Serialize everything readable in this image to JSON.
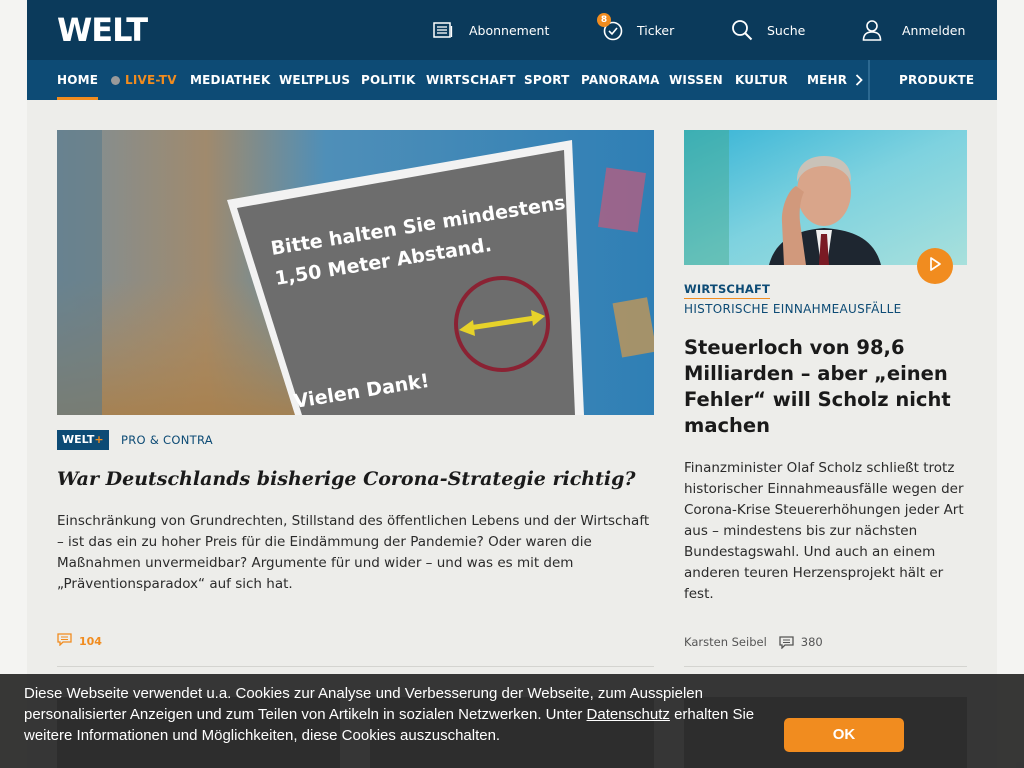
{
  "brand": {
    "logo_text": "WELT",
    "accent_color": "#f18c1f",
    "primary_color": "#0b3a5b"
  },
  "header": {
    "links": [
      {
        "label": "Abonnement",
        "icon": "newspaper-icon"
      },
      {
        "label": "Ticker",
        "icon": "clock-icon",
        "badge": "8"
      },
      {
        "label": "Suche",
        "icon": "search-icon"
      },
      {
        "label": "Anmelden",
        "icon": "user-icon"
      }
    ]
  },
  "nav": {
    "items": [
      "HOME",
      "LIVE-TV",
      "MEDIATHEK",
      "WELTPLUS",
      "POLITIK",
      "WIRTSCHAFT",
      "SPORT",
      "PANORAMA",
      "WISSEN",
      "KULTUR",
      "MEHR"
    ],
    "active": "HOME",
    "produkte": "PRODUKTE"
  },
  "left_article": {
    "image_sign_lines": [
      "Bitte halten Sie mindestens",
      "1,50 Meter Abstand.",
      "Vielen Dank!"
    ],
    "badge": {
      "text": "WELT",
      "plus": "+"
    },
    "kicker": "PRO & CONTRA",
    "headline": "War Deutschlands bisherige Corona-Strategie richtig?",
    "teaser": "Einschränkung von Grundrechten, Stillstand des öffentlichen Lebens und der Wirtschaft – ist das ein zu hoher Preis für die Eindämmung der Pandemie? Oder waren die Maßnahmen unvermeidbar? Argumente für und wider – und was es mit dem „Präventionsparadox“ auf sich hat.",
    "comments": "104"
  },
  "right_article": {
    "section": "WIRTSCHAFT",
    "kicker": "HISTORISCHE EINNAHMEAUSFÄLLE",
    "headline": "Steuerloch von 98,6 Milliarden – aber „einen Fehler“ will Scholz nicht machen",
    "teaser": "Finanzminister Olaf Scholz schließt trotz historischer Einnahmeausfälle wegen der Corona-Krise Steuererhöhungen jeder Art aus – mindestens bis zur nächsten Bundestagswahl. Und auch an einem anderen teuren Herzensprojekt hält er fest.",
    "author": "Karsten Seibel",
    "comments": "380"
  },
  "cookie_banner": {
    "text_before": "Diese Webseite verwendet u.a. Cookies zur Analyse und Verbesserung der Webseite, zum Ausspielen personalisierter Anzeigen und zum Teilen von Artikeln in sozialen Netzwerken. Unter",
    "link": "Datenschutz",
    "text_after": "erhalten Sie weitere Informationen und Möglichkeiten, diese Cookies auszuschalten.",
    "ok": "OK"
  }
}
